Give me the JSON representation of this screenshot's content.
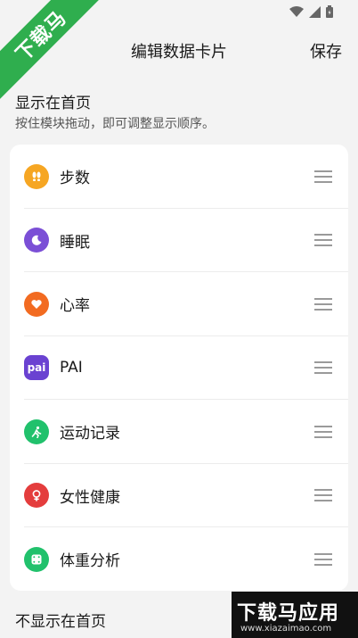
{
  "header": {
    "title": "编辑数据卡片",
    "save_label": "保存"
  },
  "shown_section": {
    "title": "显示在首页",
    "subtitle": "按住模块拖动，即可调整显示顺序。",
    "items": [
      {
        "label": "步数",
        "icon": "footsteps-icon",
        "color": "#f6a623"
      },
      {
        "label": "睡眠",
        "icon": "moon-icon",
        "color": "#7b4fd6"
      },
      {
        "label": "心率",
        "icon": "heart-icon",
        "color": "#f26b21"
      },
      {
        "label": "PAI",
        "icon": "pai-icon",
        "icon_text": "pai",
        "color": "#6a42d1"
      },
      {
        "label": "运动记录",
        "icon": "runner-icon",
        "color": "#21c16c"
      },
      {
        "label": "女性健康",
        "icon": "female-health-icon",
        "color": "#e43d3d"
      },
      {
        "label": "体重分析",
        "icon": "scale-icon",
        "color": "#21c16c"
      }
    ]
  },
  "hidden_section": {
    "title": "不显示在首页"
  },
  "watermark": {
    "corner_text": "下载马",
    "brand_text": "下载马应用",
    "url": "www.xiazaimao.com"
  }
}
